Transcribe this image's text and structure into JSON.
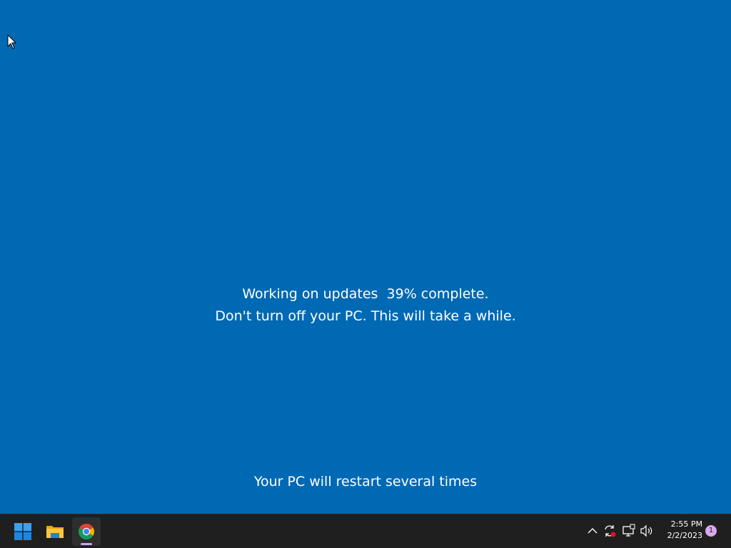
{
  "update_screen": {
    "progress_line": "Working on updates  39% complete.",
    "warning_line": "Don't turn off your PC. This will take a while.",
    "restart_line": "Your PC will restart several times",
    "progress_percent": 39,
    "background_color": "#0069b3"
  },
  "taskbar": {
    "apps": [
      {
        "name": "Start",
        "icon": "windows-logo-icon"
      },
      {
        "name": "File Explorer",
        "icon": "folder-icon"
      },
      {
        "name": "Google Chrome",
        "icon": "chrome-icon",
        "active": true
      }
    ],
    "tray": {
      "icons": [
        "chevron-up-icon",
        "sync-icon",
        "network-icon",
        "volume-icon"
      ],
      "time": "2:55 PM",
      "date": "2/2/2023",
      "notification_count": "1"
    }
  }
}
